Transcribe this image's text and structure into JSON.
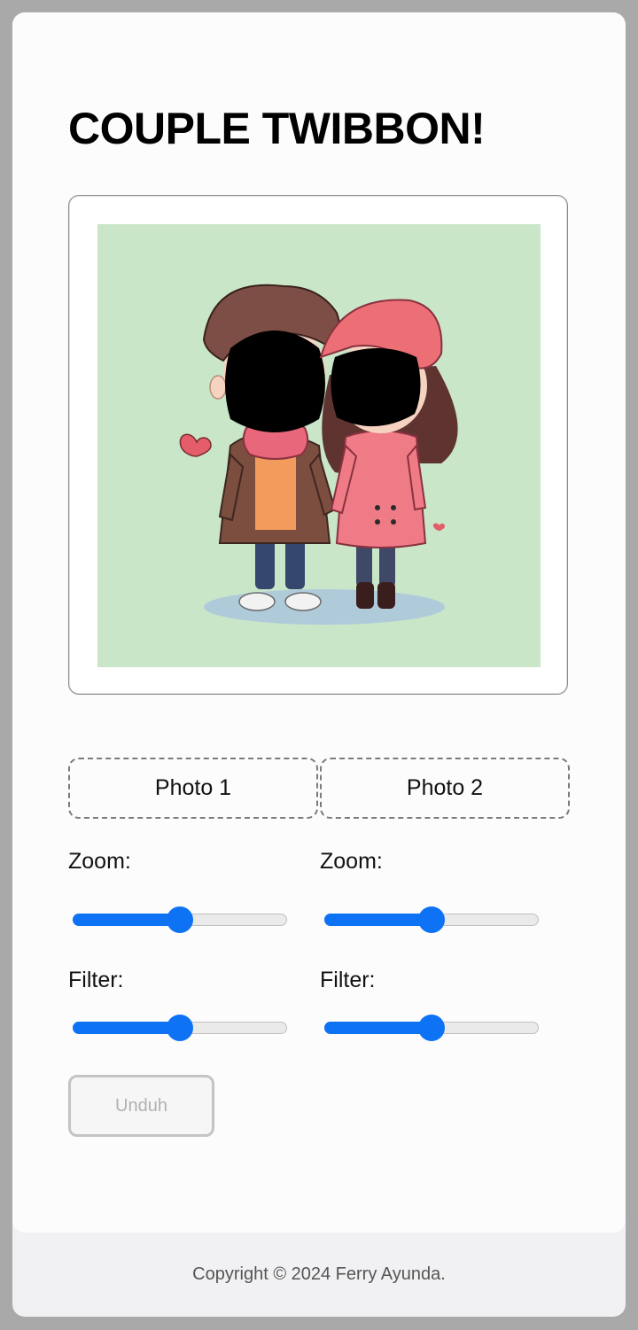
{
  "app": {
    "title": "COUPLE TWIBBON!"
  },
  "uploads": [
    {
      "label": "Photo 1"
    },
    {
      "label": "Photo 2"
    }
  ],
  "controls": {
    "photo1": {
      "zoom_label": "Zoom:",
      "zoom_value": 0.5,
      "filter_label": "Filter:",
      "filter_value": 0.5
    },
    "photo2": {
      "zoom_label": "Zoom:",
      "zoom_value": 0.5,
      "filter_label": "Filter:",
      "filter_value": 0.5
    }
  },
  "download": {
    "label": "Unduh",
    "enabled": false
  },
  "footer": {
    "copyright": "Copyright © 2024 Ferry Ayunda."
  },
  "colors": {
    "accent": "#0d72f4",
    "preview_background": "#c9e6c9"
  }
}
